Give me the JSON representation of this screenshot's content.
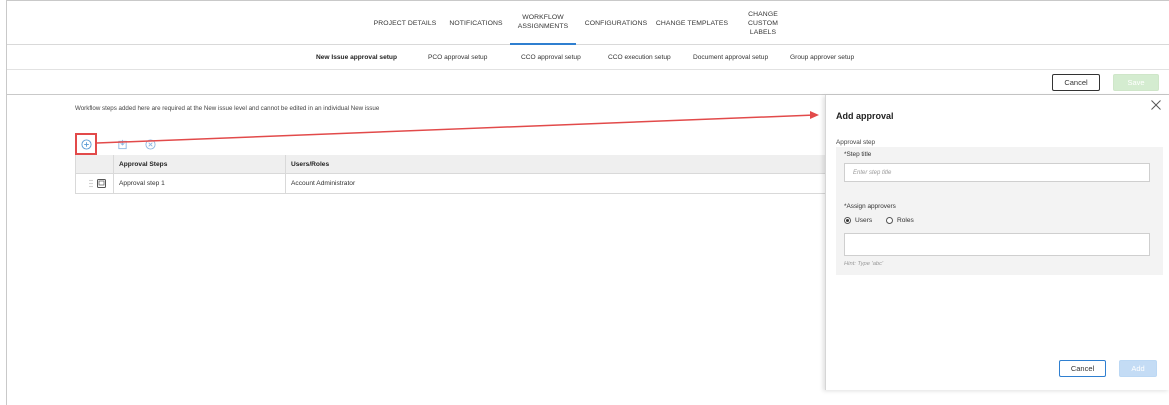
{
  "nav": {
    "tabs": [
      {
        "label": "PROJECT DETAILS"
      },
      {
        "label": "NOTIFICATIONS"
      },
      {
        "label": "WORKFLOW ASSIGNMENTS"
      },
      {
        "label": "CONFIGURATIONS"
      },
      {
        "label": "CHANGE TEMPLATES"
      },
      {
        "label": "CHANGE CUSTOM LABELS"
      }
    ],
    "active_tab": "WORKFLOW ASSIGNMENTS"
  },
  "subnav": {
    "tabs": [
      {
        "label": "New Issue approval setup"
      },
      {
        "label": "PCO approval setup"
      },
      {
        "label": "CCO approval setup"
      },
      {
        "label": "CCO execution setup"
      },
      {
        "label": "Document approval setup"
      },
      {
        "label": "Group approver setup"
      }
    ],
    "active_tab": "New Issue approval setup"
  },
  "actions": {
    "cancel_label": "Cancel",
    "save_label": "Save"
  },
  "content": {
    "note": "Workflow steps added here are required at the New issue level and cannot be edited in an individual New issue",
    "toolbar_icons": [
      "add-icon",
      "export-icon",
      "delete-icon"
    ],
    "table": {
      "columns": [
        "Approval Steps",
        "Users/Roles"
      ],
      "rows": [
        {
          "step": "Approval step 1",
          "users": "Account Administrator"
        }
      ]
    }
  },
  "panel": {
    "title": "Add approval",
    "section_label": "Approval step",
    "step_title_label": "*Step title",
    "step_title_placeholder": "Enter step title",
    "assign_label": "*Assign approvers",
    "radio_users": "Users",
    "radio_roles": "Roles",
    "selected_radio": "Users",
    "hint": "Hint: Type 'abc'",
    "cancel_label": "Cancel",
    "add_label": "Add"
  },
  "colors": {
    "accent": "#2f7fd0",
    "annotation": "#e24a4a",
    "save_disabled": "#d4ecd0"
  }
}
